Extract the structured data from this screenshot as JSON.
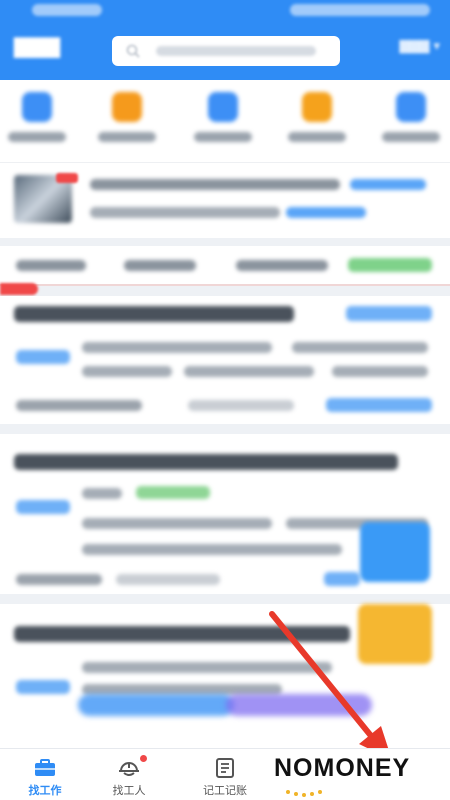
{
  "bottom_nav": {
    "items": [
      {
        "label": "找工作",
        "active": true,
        "icon": "briefcase-icon"
      },
      {
        "label": "找工人",
        "active": false,
        "icon": "worker-helmet-icon",
        "badge": true
      },
      {
        "label": "记工记账",
        "active": false,
        "icon": "ledger-icon"
      }
    ]
  },
  "watermark": {
    "text": "NOMONEY"
  },
  "colors": {
    "accent": "#2f8cf5",
    "active_nav": "#2f8cf5",
    "inactive_nav": "#666666",
    "badge": "#f04848",
    "arrow": "#e8392a",
    "float_blue": "#3a9af6",
    "float_orange": "#f5b731"
  }
}
